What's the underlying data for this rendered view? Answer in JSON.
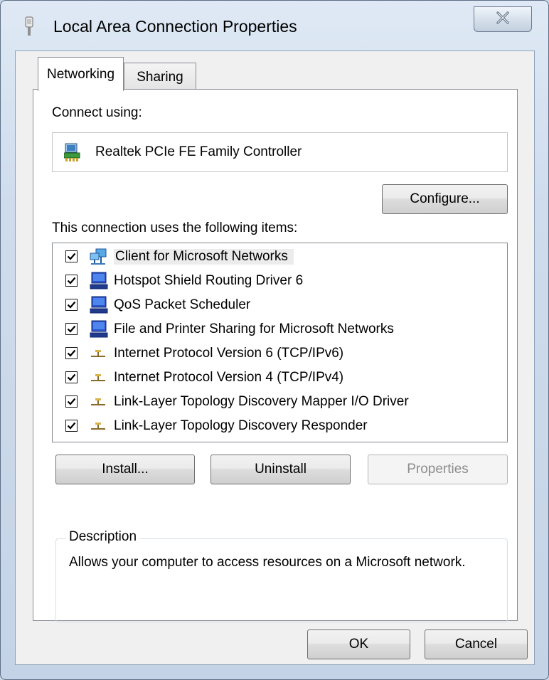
{
  "window": {
    "title": "Local Area Connection Properties",
    "close_glyph": "✕"
  },
  "tabs": [
    {
      "label": "Networking"
    },
    {
      "label": "Sharing"
    }
  ],
  "networking": {
    "connect_using_label": "Connect using:",
    "adapter_name": "Realtek PCIe FE Family Controller",
    "configure_label": "Configure...",
    "items_label": "This connection uses the following items:",
    "items": [
      {
        "label": "Client for Microsoft Networks",
        "checked": true,
        "icon": "network-client-icon"
      },
      {
        "label": "Hotspot Shield Routing Driver 6",
        "checked": true,
        "icon": "network-service-icon"
      },
      {
        "label": "QoS Packet Scheduler",
        "checked": true,
        "icon": "network-service-icon"
      },
      {
        "label": "File and Printer Sharing for Microsoft Networks",
        "checked": true,
        "icon": "network-service-icon"
      },
      {
        "label": "Internet Protocol Version 6 (TCP/IPv6)",
        "checked": true,
        "icon": "protocol-icon"
      },
      {
        "label": "Internet Protocol Version 4 (TCP/IPv4)",
        "checked": true,
        "icon": "protocol-icon"
      },
      {
        "label": "Link-Layer Topology Discovery Mapper I/O Driver",
        "checked": true,
        "icon": "protocol-icon"
      },
      {
        "label": "Link-Layer Topology Discovery Responder",
        "checked": true,
        "icon": "protocol-icon"
      }
    ],
    "install_label": "Install...",
    "uninstall_label": "Uninstall",
    "properties_label": "Properties",
    "description_legend": "Description",
    "description_text": "Allows your computer to access resources on a Microsoft network."
  },
  "footer": {
    "ok_label": "OK",
    "cancel_label": "Cancel"
  }
}
